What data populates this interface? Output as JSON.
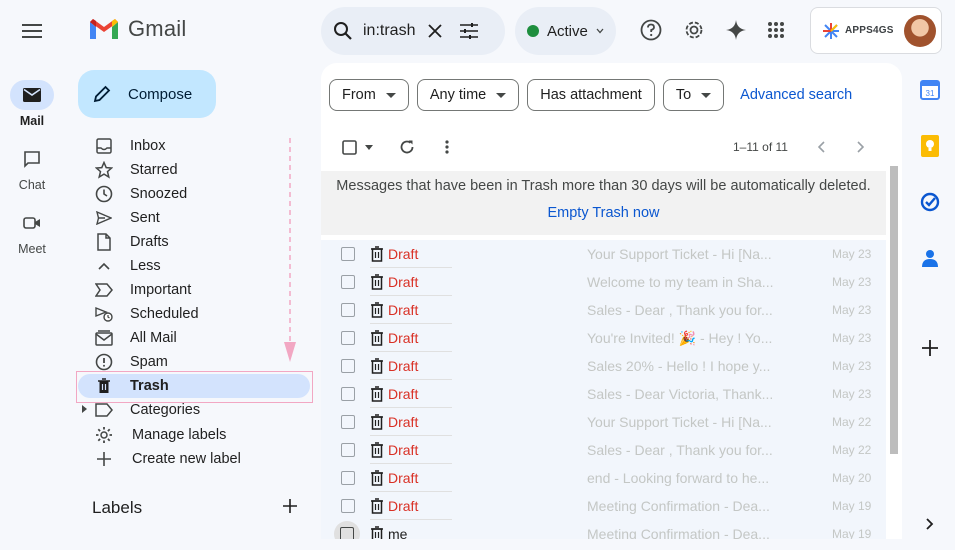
{
  "app": {
    "name": "Gmail"
  },
  "rail": {
    "items": [
      {
        "label": "Mail",
        "icon": "mail-icon",
        "active": true
      },
      {
        "label": "Chat",
        "icon": "chat-icon",
        "active": false
      },
      {
        "label": "Meet",
        "icon": "meet-icon",
        "active": false
      }
    ]
  },
  "compose": {
    "label": "Compose"
  },
  "nav": {
    "items": [
      {
        "label": "Inbox",
        "icon": "inbox-icon"
      },
      {
        "label": "Starred",
        "icon": "star-icon"
      },
      {
        "label": "Snoozed",
        "icon": "clock-icon"
      },
      {
        "label": "Sent",
        "icon": "send-icon"
      },
      {
        "label": "Drafts",
        "icon": "file-icon"
      },
      {
        "label": "Less",
        "icon": "chevron-up-icon"
      },
      {
        "label": "Important",
        "icon": "label-important-icon"
      },
      {
        "label": "Scheduled",
        "icon": "schedule-send-icon"
      },
      {
        "label": "All Mail",
        "icon": "all-mail-icon"
      },
      {
        "label": "Spam",
        "icon": "spam-icon"
      },
      {
        "label": "Trash",
        "icon": "trash-icon",
        "active": true
      },
      {
        "label": "Categories",
        "icon": "label-icon"
      },
      {
        "label": "Manage labels",
        "icon": "gear-icon"
      },
      {
        "label": "Create new label",
        "icon": "plus-icon"
      }
    ],
    "labels_heading": "Labels"
  },
  "search": {
    "value": "in:trash"
  },
  "status": {
    "label": "Active",
    "color": "#1e8e3e"
  },
  "account": {
    "brand": "APPS4GS"
  },
  "filters": {
    "chips": [
      "From",
      "Any time",
      "Has attachment",
      "To"
    ],
    "advanced": "Advanced search"
  },
  "toolbar": {
    "count": "1–11 of 11"
  },
  "notice": {
    "message": "Messages that have been in Trash more than 30 days will be automatically deleted.",
    "action": "Empty Trash now"
  },
  "emails": [
    {
      "sender": "Draft",
      "subject": "Your Support Ticket",
      "snippet": " - Hi [Na...",
      "date": "May 23"
    },
    {
      "sender": "Draft",
      "subject": "Welcome to my team in Sha...",
      "snippet": "",
      "date": "May 23"
    },
    {
      "sender": "Draft",
      "subject": "Sales",
      "snippet": " - Dear , Thank you for...",
      "date": "May 23"
    },
    {
      "sender": "Draft",
      "subject": "You're Invited! 🎉",
      "snippet": " - Hey ! Yo...",
      "date": "May 23"
    },
    {
      "sender": "Draft",
      "subject": "Sales 20%",
      "snippet": " - Hello ! I hope y...",
      "date": "May 23"
    },
    {
      "sender": "Draft",
      "subject": "Sales",
      "snippet": " - Dear Victoria, Thank...",
      "date": "May 23"
    },
    {
      "sender": "Draft",
      "subject": "Your Support Ticket",
      "snippet": " - Hi [Na...",
      "date": "May 22"
    },
    {
      "sender": "Draft",
      "subject": "Sales",
      "snippet": " - Dear , Thank you for...",
      "date": "May 22"
    },
    {
      "sender": "Draft",
      "subject": "end",
      "snippet": " - Looking forward to he...",
      "date": "May 20"
    },
    {
      "sender": "Draft",
      "subject": "Meeting Confirmation",
      "snippet": " - Dea...",
      "date": "May 19"
    },
    {
      "sender": "me",
      "subject": "Meeting Confirmation",
      "snippet": " - Dea...",
      "date": "May 19"
    }
  ]
}
